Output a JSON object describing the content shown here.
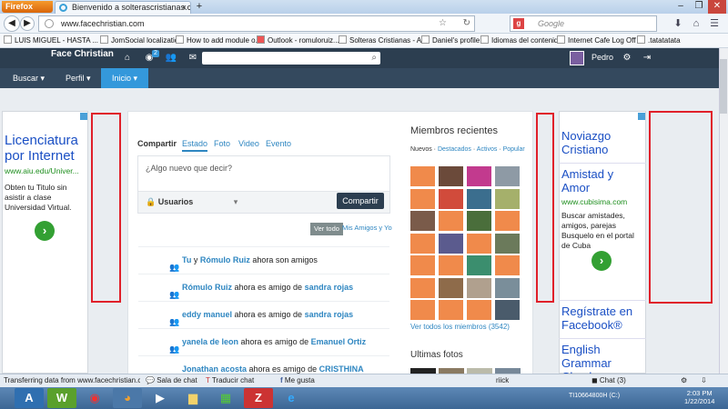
{
  "browser": {
    "app_button": "Firefox",
    "tab_title": "Bienvenido a solterascristianas.com",
    "url": "www.facechristian.com",
    "search_engine_placeholder": "Google",
    "bookmarks": [
      "LUIS MIGUEL - HASTA ...",
      "JomSocial localization",
      "How to add module o...",
      "Outlook - romuloruiz...",
      "Solteras Cristianas - A...",
      "Daniel's profile",
      "Idiomas del contenido",
      "Internet Cafe Log Off",
      ".tatatatata"
    ]
  },
  "site": {
    "brand": "Face Christian",
    "notification_count": "2",
    "user_name": "Pedro",
    "menu": [
      "Buscar",
      "Perfil",
      "Inicio"
    ]
  },
  "ad_left": {
    "title": "Licenciatura por Internet",
    "url": "www.aiu.edu/Univer...",
    "text": "Obten tu Titulo sin asistir a clase Universidad Virtual."
  },
  "ad_right": {
    "ad1_title": "Noviazgo Cristiano",
    "ad2_title": "Amistad y Amor",
    "ad2_url": "www.cubisima.com",
    "ad2_text": "Buscar amistades, amigos, parejas Busquelo en el portal de Cuba",
    "ad3_title": "Regístrate en Facebook®",
    "ad4_title": "English Grammar Check"
  },
  "composer": {
    "tabs": [
      "Compartir",
      "Estado",
      "Foto",
      "Video",
      "Evento"
    ],
    "placeholder": "¿Algo nuevo que decir?",
    "privacy": "Usuarios",
    "submit": "Compartir",
    "filter_all": "Ver todo",
    "filter_friends": "Mis Amigos y Yo"
  },
  "activity": [
    {
      "a": "Tu",
      "mid": " y ",
      "b": "Rómulo Ruiz",
      "end": " ahora son amigos"
    },
    {
      "a": "Rómulo Ruiz",
      "mid": " ahora es amigo de ",
      "b": "sandra rojas",
      "end": ""
    },
    {
      "a": "eddy manuel",
      "mid": " ahora es amigo de ",
      "b": "sandra rojas",
      "end": ""
    },
    {
      "a": "yanela de leon",
      "mid": " ahora es amigo de ",
      "b": "Emanuel Ortiz",
      "end": ""
    },
    {
      "a": "Jonathan acosta",
      "mid": " ahora es amigo de ",
      "b": "CRISTHINA",
      "end": ""
    }
  ],
  "members": {
    "title": "Miembros recientes",
    "filter_label": "Nuevos",
    "filters": [
      "Destacados",
      "Activos",
      "Popular"
    ],
    "view_all": "Ver todos los miembros (3542)",
    "photos_title": "Ultimas fotos"
  },
  "statusbar": {
    "loading": "Transferring data from www.facechristian.com...",
    "chat_room": "Sala de chat",
    "translate": "Traducir chat",
    "like": "Me gusta",
    "user": "riick",
    "chat": "Chat (3)"
  },
  "taskbar": {
    "drive": "TI10664800H (C:)",
    "time": "2:03 PM",
    "date": "1/22/2014"
  }
}
